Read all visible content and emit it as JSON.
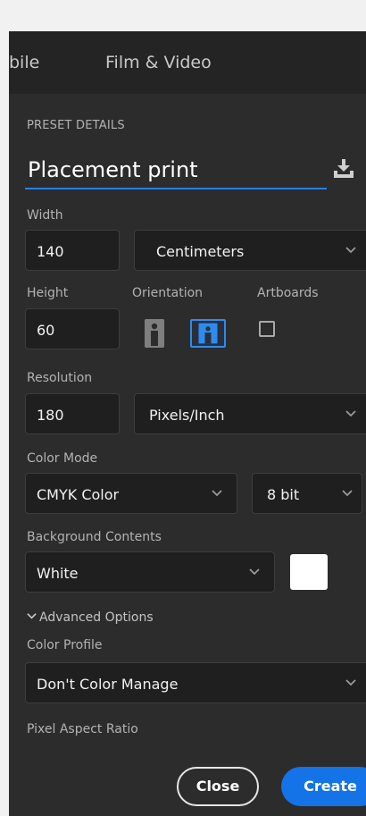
{
  "tabs": {
    "partial_tab": "bile",
    "film_video": "Film & Video"
  },
  "preset": {
    "section_label": "PRESET DETAILS",
    "name": "Placement print"
  },
  "width": {
    "label": "Width",
    "value": "140",
    "unit": "Centimeters"
  },
  "height": {
    "label": "Height",
    "value": "60"
  },
  "orientation": {
    "label": "Orientation",
    "selected": "landscape"
  },
  "artboards": {
    "label": "Artboards",
    "checked": false
  },
  "resolution": {
    "label": "Resolution",
    "value": "180",
    "unit": "Pixels/Inch"
  },
  "color_mode": {
    "label": "Color Mode",
    "mode": "CMYK Color",
    "depth": "8 bit"
  },
  "background": {
    "label": "Background Contents",
    "value": "White",
    "swatch_color": "#ffffff"
  },
  "advanced": {
    "toggle_label": "Advanced Options"
  },
  "color_profile": {
    "label": "Color Profile",
    "value": "Don't Color Manage"
  },
  "pixel_aspect": {
    "label": "Pixel Aspect Ratio"
  },
  "buttons": {
    "close": "Close",
    "create": "Create"
  },
  "colors": {
    "accent": "#1473e6",
    "panel": "#2c2c2c",
    "field": "#1f1f1f"
  },
  "icons": {
    "save_preset": "save-preset-icon",
    "chevron": "chevron-down-icon",
    "portrait": "portrait-icon",
    "landscape": "landscape-icon"
  }
}
